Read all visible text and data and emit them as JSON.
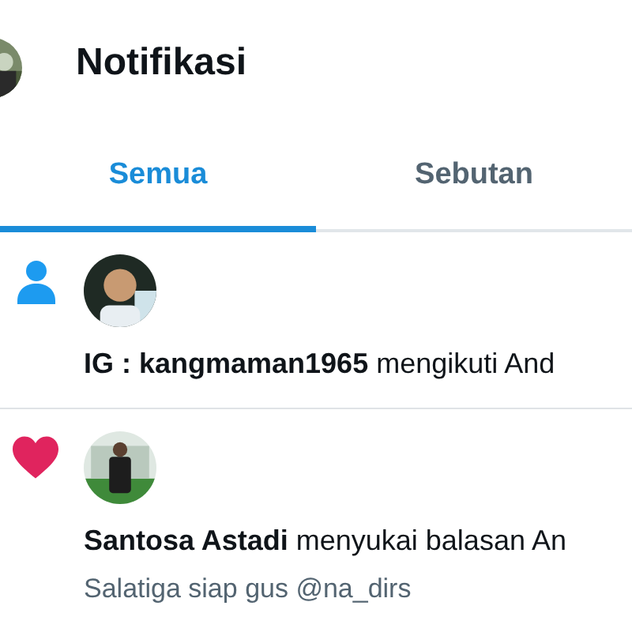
{
  "header": {
    "title": "Notifikasi"
  },
  "tabs": [
    {
      "label": "Semua",
      "selected": true
    },
    {
      "label": "Sebutan",
      "selected": false
    }
  ],
  "notifications": [
    {
      "kind": "follow",
      "text": "**IG : kangmaman1965** mengikuti And"
    },
    {
      "kind": "like",
      "text": "**Santosa Astadi** menyukai balasan An",
      "snippet": "Salatiga siap gus @na_dirs"
    }
  ]
}
